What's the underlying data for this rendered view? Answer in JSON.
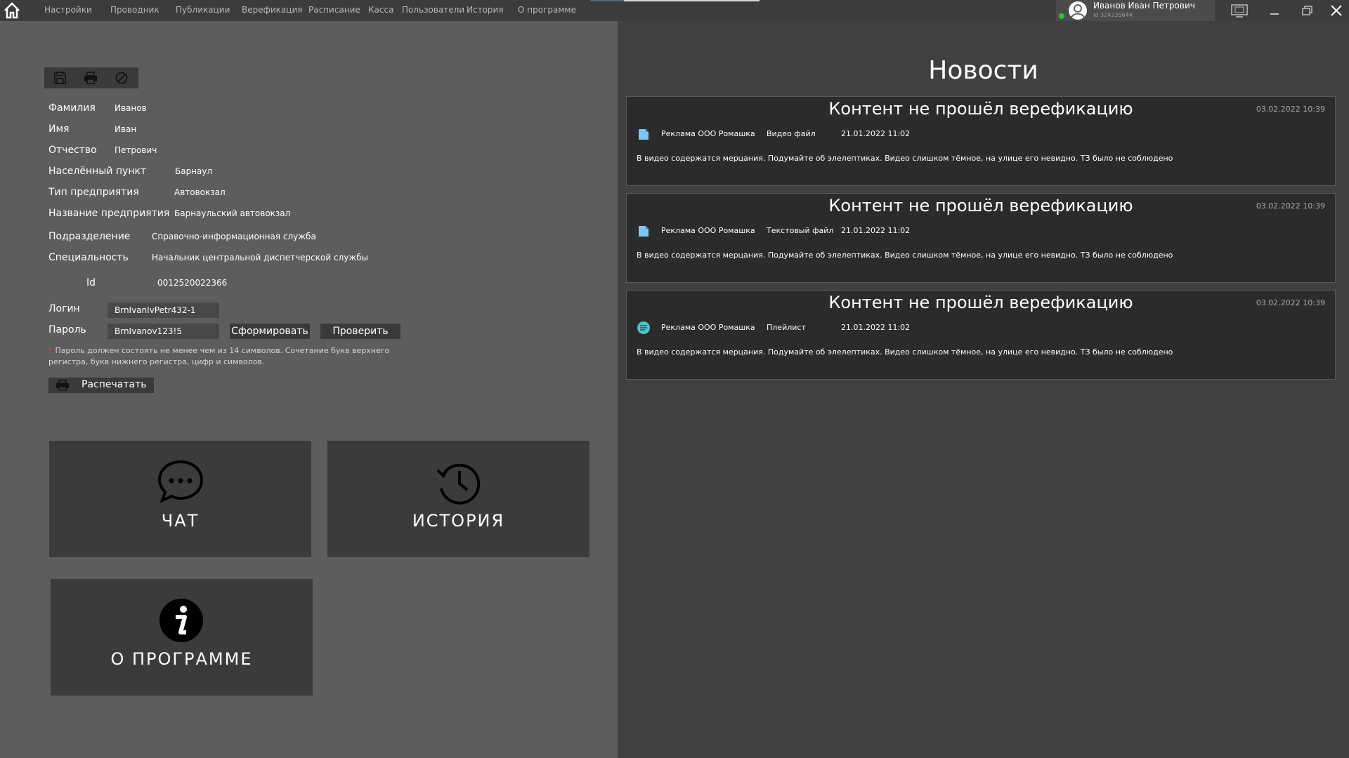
{
  "menu": {
    "items": [
      {
        "label": "Настройки"
      },
      {
        "label": "Проводник"
      },
      {
        "label": "Публикации"
      },
      {
        "label": "Верефикация"
      },
      {
        "label": "Расписание"
      },
      {
        "label": "Касса"
      },
      {
        "label": "Пользователи"
      },
      {
        "label": "История"
      },
      {
        "label": "О программе"
      }
    ]
  },
  "user": {
    "name": "Иванов Иван Петрович",
    "id_text": "Id 324235644",
    "status_color": "#2ec62e"
  },
  "icons": {
    "home": "home-icon",
    "avatar": "user-avatar-icon",
    "remote": "remote-desktop-icon",
    "minimize": "minimize-icon",
    "restore": "restore-icon",
    "close": "close-icon",
    "save": "floppy-disk-icon",
    "print": "printer-icon",
    "cancel": "cancel-icon"
  },
  "profile": {
    "fields": [
      {
        "label": "Фамилия",
        "value": "Иванов"
      },
      {
        "label": "Имя",
        "value": "Иван"
      },
      {
        "label": "Отчество",
        "value": "Петрович"
      },
      {
        "label": "Населённый пункт",
        "value": "Барнаул"
      },
      {
        "label": "Тип предприятия",
        "value": "Автовокзал"
      },
      {
        "label": "Название предприятия",
        "value": "Барнаульский автовокзал"
      },
      {
        "label": "Подразделение",
        "value": "Справочно-информационная служба"
      },
      {
        "label": "Специальность",
        "value": "Начальник центральной диспетчерской службы"
      },
      {
        "label": "Id",
        "value": "0012520022366"
      }
    ],
    "login_label": "Логин",
    "login_value": "BrnIvanIvPetr432-1",
    "password_label": "Пароль",
    "password_value": "BrnIvanov123!5",
    "generate_label": "Сформировать",
    "check_label": "Проверить",
    "password_hint": "Пароль должен состоять не менее чем из 14 символов. Сочетание букв верхнего регистра, букв нижнего регистра, цифр и символов.",
    "hint_marker": "*",
    "print_label": "Распечатать"
  },
  "tiles": {
    "chat": "ЧАТ",
    "history": "ИСТОРИЯ",
    "about": "О ПРОГРАММЕ"
  },
  "news": {
    "title": "Новости",
    "items": [
      {
        "title": "Контент не прошёл верефикацию",
        "timestamp": "03.02.2022 10:39",
        "icon": "file-icon",
        "company": "Реклама ООО Ромашка",
        "type": "Видео файл",
        "date": "21.01.2022  11:02",
        "text": "В видео содержатся мерцания. Подумайте об элелептиках. Видео слишком тёмное, на улице его невидно. ТЗ было не соблюдено"
      },
      {
        "title": "Контент не прошёл верефикацию",
        "timestamp": "03.02.2022 10:39",
        "icon": "file-icon",
        "company": "Реклама ООО Ромашка",
        "type": "Текстовый файл",
        "date": "21.01.2022  11:02",
        "text": "В видео содержатся мерцания. Подумайте об элелептиках. Видео слишком тёмное, на улице его невидно. ТЗ было не соблюдено"
      },
      {
        "title": "Контент не прошёл верефикацию",
        "timestamp": "03.02.2022 10:39",
        "icon": "playlist-icon",
        "company": "Реклама ООО Ромашка",
        "type": "Плейлист",
        "date": "21.01.2022  11:02",
        "text": "В видео содержатся мерцания. Подумайте об элелептиках. Видео слишком тёмное, на улице его невидно. ТЗ было не соблюдено"
      }
    ]
  }
}
